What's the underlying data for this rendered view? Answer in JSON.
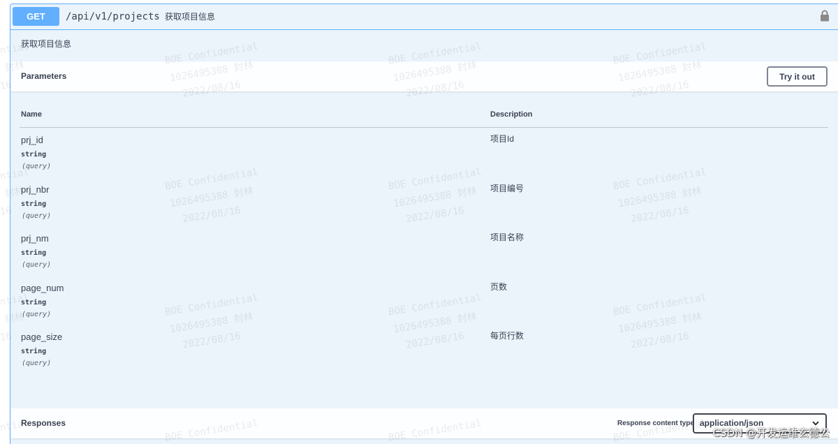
{
  "colors": {
    "accent": "#61affe",
    "block_background": "#ebf3fb",
    "text": "#3b4151"
  },
  "operation": {
    "method": "GET",
    "path": "/api/v1/projects",
    "summary": "获取项目信息",
    "description": "获取项目信息",
    "lock_icon": "lock-icon"
  },
  "parameters": {
    "title": "Parameters",
    "try_it_out_label": "Try it out",
    "columns": {
      "name": "Name",
      "description": "Description"
    },
    "rows": [
      {
        "name": "prj_id",
        "type": "string",
        "location": "(query)",
        "description": "项目Id"
      },
      {
        "name": "prj_nbr",
        "type": "string",
        "location": "(query)",
        "description": "项目编号"
      },
      {
        "name": "prj_nm",
        "type": "string",
        "location": "(query)",
        "description": "项目名称"
      },
      {
        "name": "page_num",
        "type": "string",
        "location": "(query)",
        "description": "页数"
      },
      {
        "name": "page_size",
        "type": "string",
        "location": "(query)",
        "description": "每页行数"
      }
    ]
  },
  "responses": {
    "title": "Responses",
    "content_type_label": "Response content type",
    "content_type_value": "application/json",
    "chevron_icon": "chevron-down-icon"
  },
  "watermark": {
    "lines": [
      "BOE Confidential",
      "1026495388 封林",
      "2022/08/16"
    ]
  },
  "credit": "CSDN @开发运维玄德公"
}
